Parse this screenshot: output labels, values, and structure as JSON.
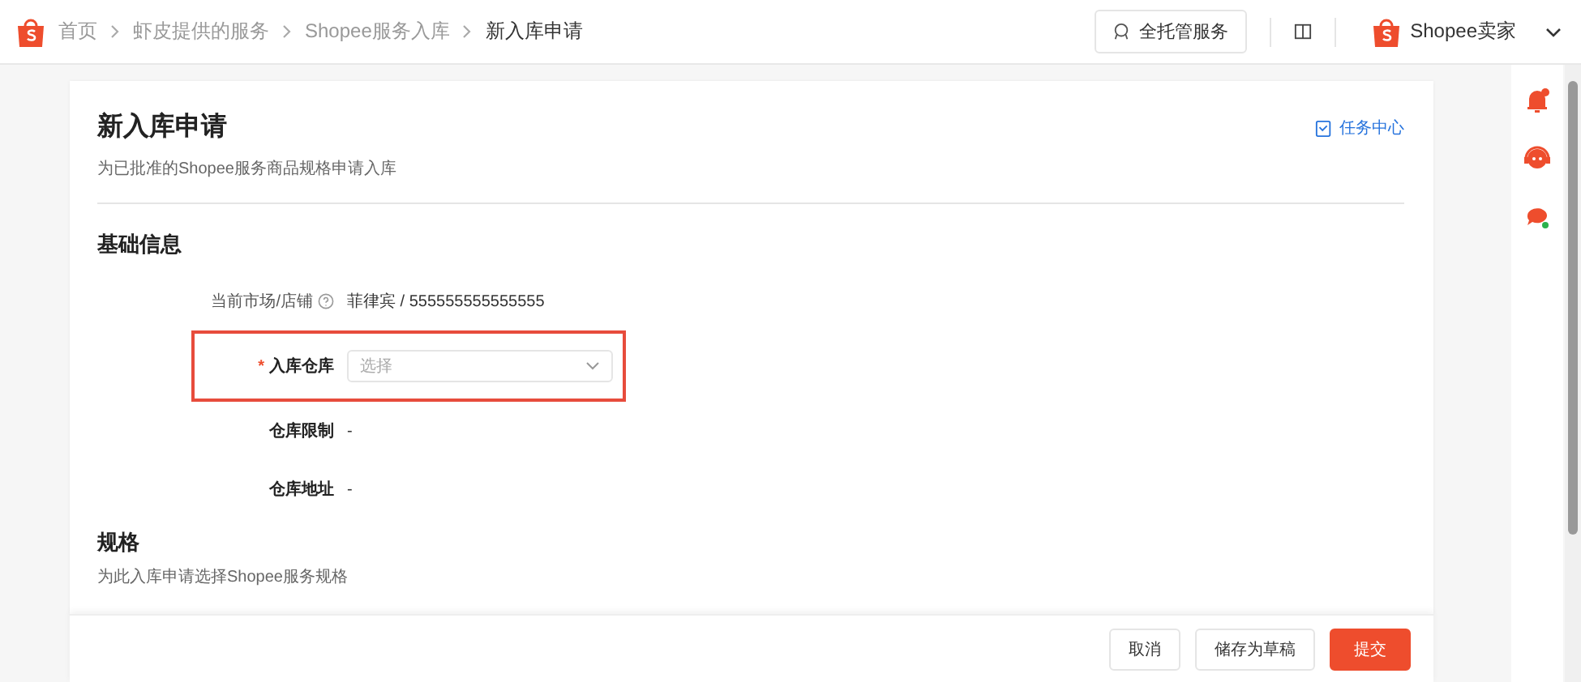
{
  "breadcrumb": [
    {
      "label": "首页",
      "current": false
    },
    {
      "label": "虾皮提供的服务",
      "current": false
    },
    {
      "label": "Shopee服务入库",
      "current": false
    },
    {
      "label": "新入库申请",
      "current": true
    }
  ],
  "header": {
    "service_button": "全托管服务",
    "account": "Shopee卖家"
  },
  "page": {
    "title": "新入库申请",
    "subtitle": "为已批准的Shopee服务商品规格申请入库",
    "task_center": "任务中心"
  },
  "basic": {
    "title": "基础信息",
    "fields": [
      {
        "kind": "text",
        "label": "当前市场/店铺",
        "help": true,
        "value": "菲律宾 / 555555555555555",
        "highlighted": false
      },
      {
        "kind": "select",
        "label": "入库仓库",
        "help": false,
        "required_mark": "*",
        "placeholder": "选择",
        "highlighted": true
      },
      {
        "kind": "text",
        "label": "仓库限制",
        "help": false,
        "value": "-",
        "highlighted": false
      },
      {
        "kind": "text",
        "label": "仓库地址",
        "help": false,
        "value": "-",
        "highlighted": false
      }
    ]
  },
  "spec": {
    "title": "规格",
    "subtitle": "为此入库申请选择Shopee服务规格"
  },
  "footer": {
    "buttons": [
      {
        "label": "取消",
        "primary": false
      },
      {
        "label": "储存为草稿",
        "primary": false
      },
      {
        "label": "提交",
        "primary": true
      }
    ]
  }
}
